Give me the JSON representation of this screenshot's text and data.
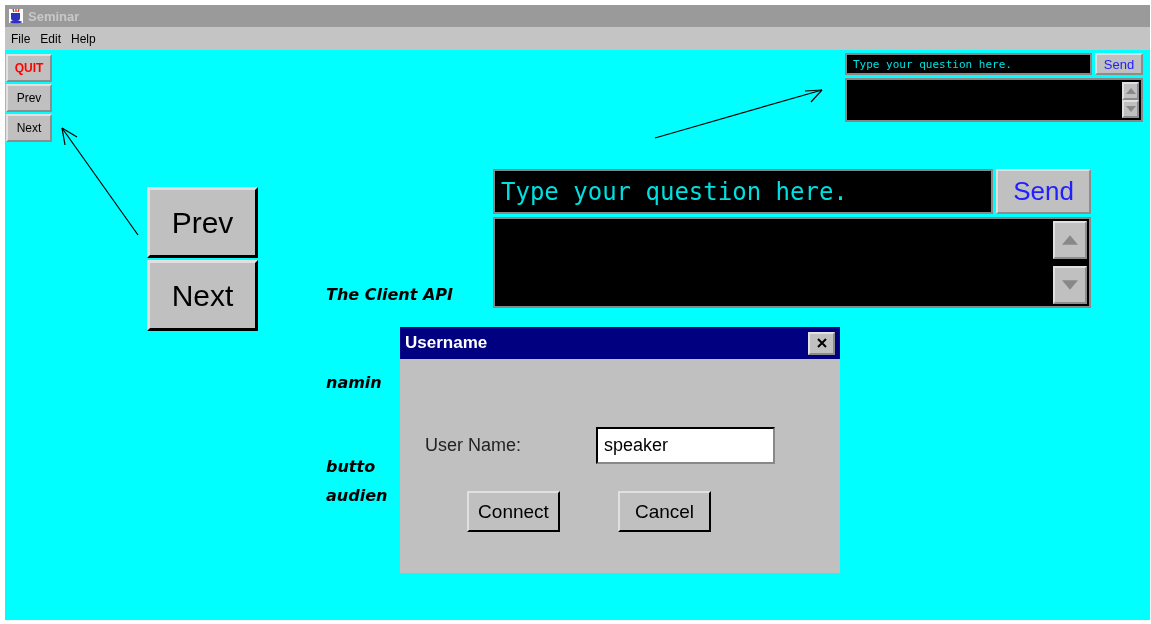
{
  "window": {
    "title": "Seminar"
  },
  "menu": [
    "File",
    "Edit",
    "Help"
  ],
  "nav_buttons": [
    {
      "label": "QUIT",
      "kind": "quit"
    },
    {
      "label": "Prev",
      "kind": "normal"
    },
    {
      "label": "Next",
      "kind": "normal"
    }
  ],
  "slide_buttons": [
    "Prev",
    "Next"
  ],
  "corner_question_panel": {
    "placeholder": "Type your question here.",
    "send": "Send"
  },
  "enlarged_question_panel": {
    "placeholder": "Type your question here.",
    "send": "Send"
  },
  "slide_texts": [
    "The Client API",
    "namin",
    "butto",
    "audien"
  ],
  "dialog": {
    "title": "Username",
    "label": "User Name:",
    "value": "speaker",
    "buttons": [
      "Connect",
      "Cancel"
    ]
  }
}
